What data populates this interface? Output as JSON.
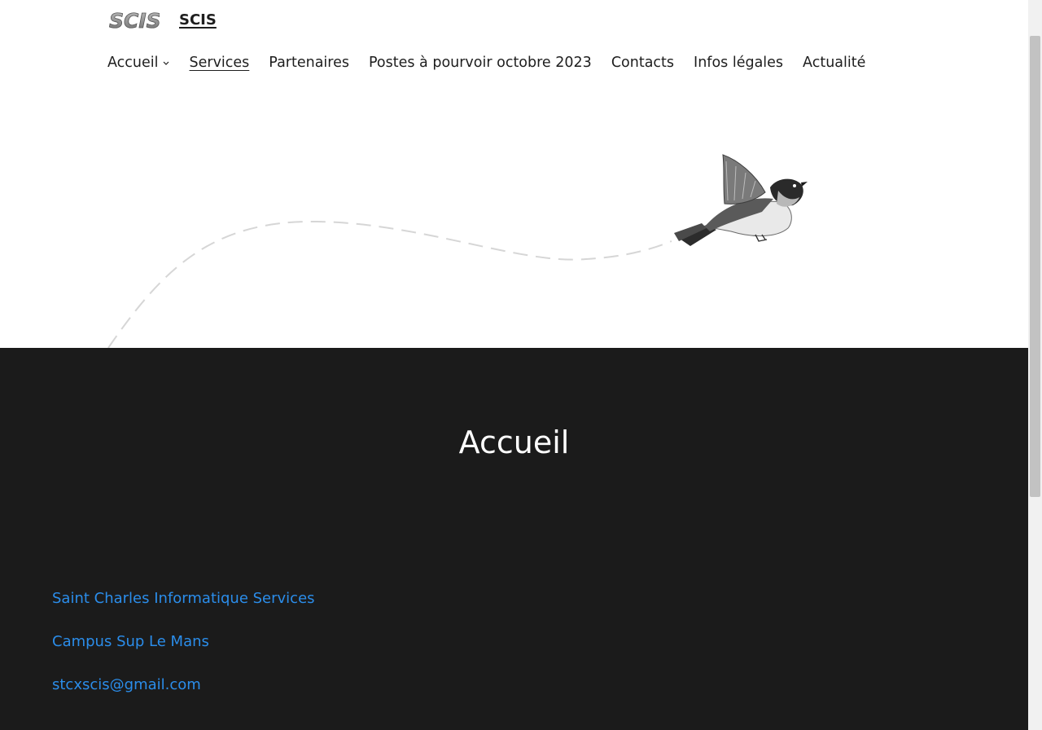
{
  "header": {
    "site_title": "SCIS",
    "logo_alt": "SCIS"
  },
  "nav": {
    "items": [
      {
        "label": "Accueil",
        "has_submenu": true
      },
      {
        "label": "Services",
        "current": true
      },
      {
        "label": "Partenaires"
      },
      {
        "label": "Postes à pourvoir octobre 2023"
      },
      {
        "label": "Contacts"
      },
      {
        "label": "Infos légales"
      },
      {
        "label": "Actualité"
      }
    ]
  },
  "footer": {
    "title": "Accueil",
    "links": [
      "Saint Charles Informatique Services",
      "Campus Sup Le Mans",
      "stcxscis@gmail.com"
    ]
  },
  "colors": {
    "footer_bg": "#1b1b1b",
    "link": "#2b8dea",
    "text": "#1e1e1e"
  }
}
